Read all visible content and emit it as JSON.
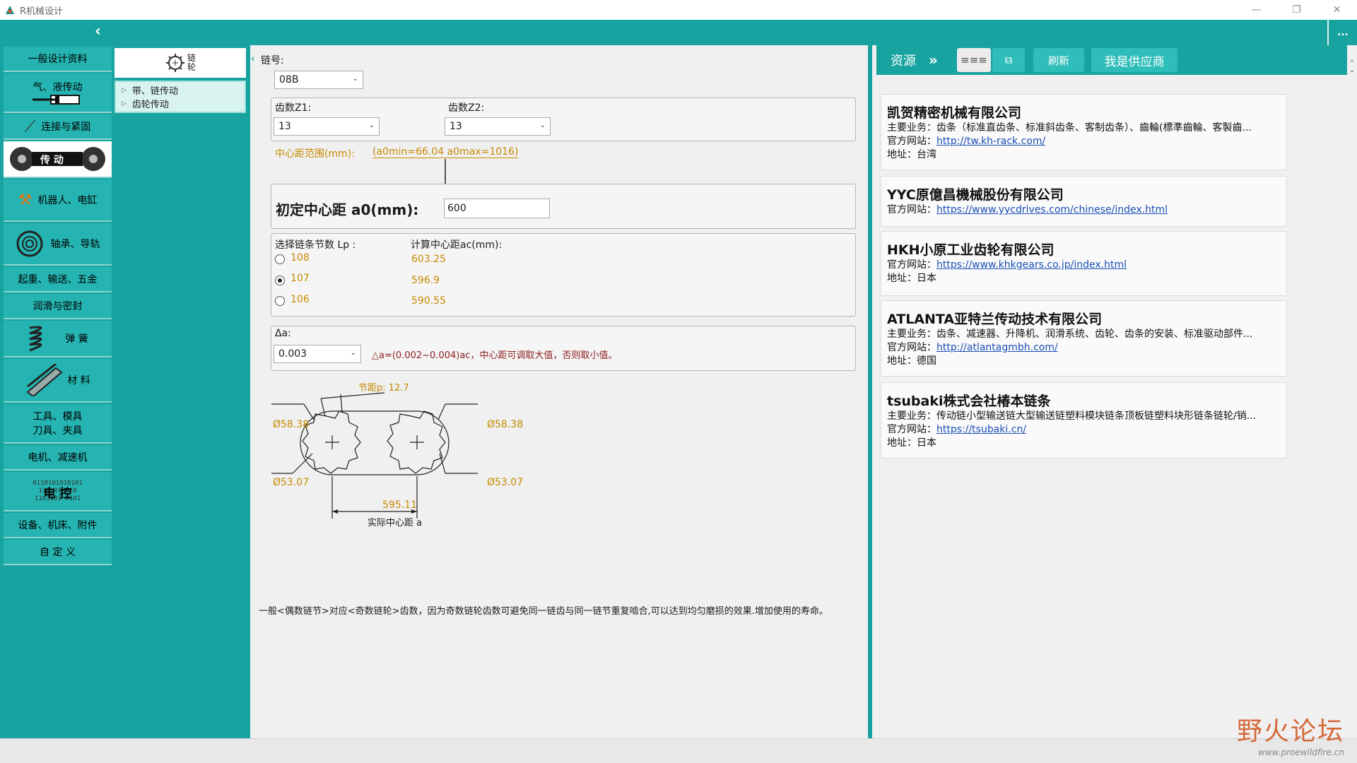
{
  "window": {
    "title": "R机械设计",
    "controls": [
      "—",
      "❐",
      "✕"
    ]
  },
  "topbar": {
    "collapse_icon": "chevron-left-icon",
    "more_label": "..."
  },
  "nav": {
    "items": [
      {
        "label": "一般设计资料"
      },
      {
        "label": "气、液传动"
      },
      {
        "label": "连接与紧固"
      },
      {
        "label": "传 动"
      },
      {
        "label": "机器人、电缸"
      },
      {
        "label": "轴承、导轨"
      },
      {
        "label": "起重、输送、五金"
      },
      {
        "label": "润滑与密封"
      },
      {
        "label": "弹 簧"
      },
      {
        "label": "材 料"
      },
      {
        "label": "工具、模具"
      },
      {
        "label": "电机、减速机"
      },
      {
        "label": "电 控"
      },
      {
        "label": "设备、机床、附件"
      },
      {
        "label": "自 定 义"
      }
    ],
    "tool_line2": "刀具、夹具",
    "binary_text": [
      "0110101010101",
      "110  01 010",
      "1101101 0101"
    ]
  },
  "tree": {
    "header": "链轮",
    "header_top": "链",
    "header_bottom": "轮",
    "items": [
      "带、链传动",
      "齿轮传动"
    ]
  },
  "form": {
    "chain_no_label": "链号:",
    "chain_no_value": "08B",
    "z1_label": "齿数Z1:",
    "z1_value": "13",
    "z2_label": "齿数Z2:",
    "z2_value": "13",
    "range_label": "中心距范围(mm):",
    "range_value": "(a0min=66.04  a0max=1016)",
    "a0_label": "初定中心距 a0(mm):",
    "a0_value": "600",
    "lp_label": "选择链条节数 Lp :",
    "ac_label": "计算中心距ac(mm):",
    "options": [
      {
        "lp": "108",
        "ac": "603.25",
        "checked": false
      },
      {
        "lp": "107",
        "ac": "596.9",
        "checked": true
      },
      {
        "lp": "106",
        "ac": "590.55",
        "checked": false
      }
    ],
    "delta_label": "Δa:",
    "delta_value": "0.003",
    "delta_note": "△a=(0.002~0.004)ac，中心距可调取大值，否则取小值。",
    "footnote": "一般<偶数链节>对应<奇数链轮>齿数，因为奇数链轮齿数可避免同一链齿与同一链节重复啮合,可以达到均匀磨损的效果.增加使用的寿命。"
  },
  "diagram": {
    "pitch_label": "节距p:  12.7",
    "d_outer": "Ø58.38",
    "d_inner": "Ø53.07",
    "center_value": "595.11",
    "center_label": "实际中心距 a"
  },
  "resources": {
    "title": "资源",
    "buttons": {
      "list": "≡≡≡",
      "copy": "⧉",
      "refresh": "刷新",
      "supplier": "我是供应商"
    },
    "companies": [
      {
        "name": "凯贺精密机械有限公司",
        "lines": [
          {
            "k": "主要业务：",
            "v": "齿条（标准直齿条、标准斜齿条、客制齿条）、齒輪(標準齒輪、客製齒..."
          },
          {
            "k": "官方网站：",
            "v": "http://tw.kh-rack.com/",
            "link": true
          },
          {
            "k": "地址：",
            "v": "台湾"
          }
        ]
      },
      {
        "name": "YYC原億昌機械股份有限公司",
        "lines": [
          {
            "k": "官方网站：",
            "v": "https://www.yycdrives.com/chinese/index.html",
            "link": true
          }
        ]
      },
      {
        "name": "HKH小原工业齿轮有限公司",
        "lines": [
          {
            "k": "官方网站：",
            "v": "https://www.khkgears.co.jp/index.html",
            "link": true
          },
          {
            "k": "地址：",
            "v": "日本"
          }
        ]
      },
      {
        "name": "ATLANTA亚特兰传动技术有限公司",
        "lines": [
          {
            "k": "主要业务：",
            "v": "齿条、减速器、升降机、润滑系统、齿轮、齿条的安装、标准驱动部件..."
          },
          {
            "k": "官方网站：",
            "v": "http://atlantagmbh.com/",
            "link": true
          },
          {
            "k": "地址：",
            "v": "德国"
          }
        ]
      },
      {
        "name": "tsubaki株式会社椿本链条",
        "lines": [
          {
            "k": "主要业务：",
            "v": "传动链小型输送链大型输送链塑料模块链条顶板链塑料块形链条链轮/销..."
          },
          {
            "k": "官方网站：",
            "v": "https://tsubaki.cn/",
            "link": true
          },
          {
            "k": "地址：",
            "v": "日本"
          }
        ]
      }
    ]
  },
  "watermark": {
    "big": "野火论坛",
    "small": "www.proewildfire.cn"
  },
  "colors": {
    "teal": "#18a3a1",
    "teal_light": "#25b4b1",
    "orange": "#c68a00",
    "link": "#1a4fb5"
  }
}
